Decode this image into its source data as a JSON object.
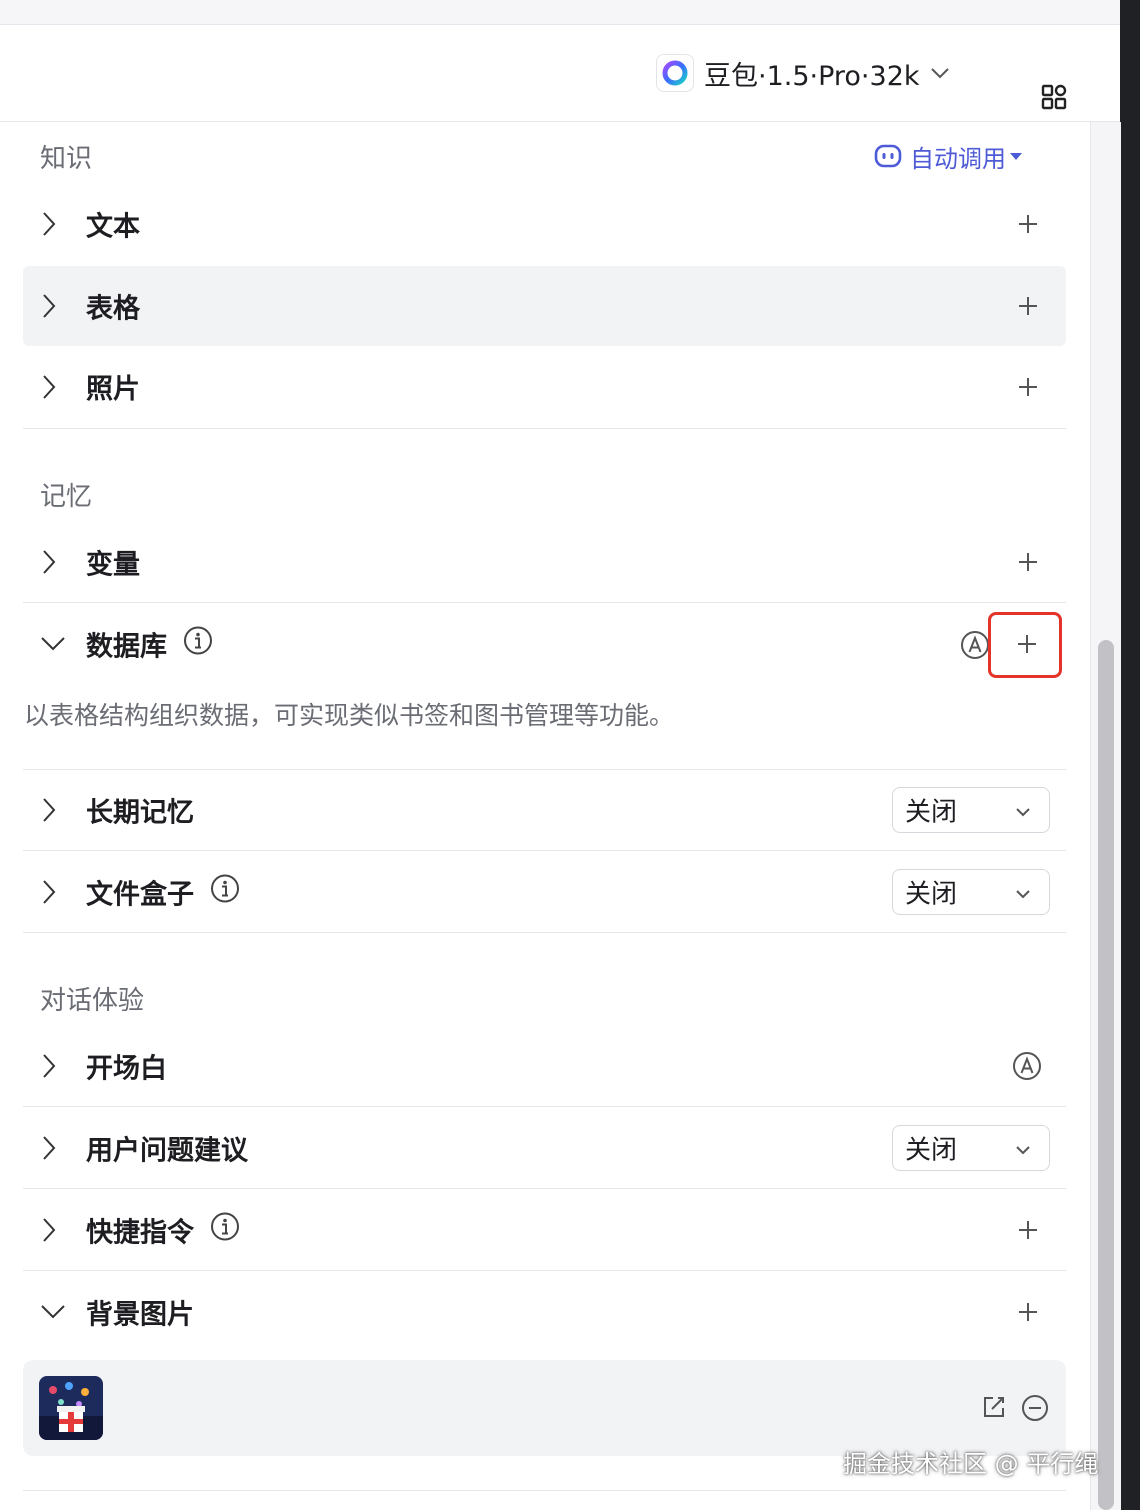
{
  "header": {
    "model_name": "豆包·1.5·Pro·32k"
  },
  "knowledge": {
    "title": "知识",
    "auto_call_label": "自动调用",
    "items": [
      {
        "label": "文本"
      },
      {
        "label": "表格"
      },
      {
        "label": "照片"
      }
    ]
  },
  "memory": {
    "title": "记忆",
    "variables_label": "变量",
    "database_label": "数据库",
    "database_description": "以表格结构组织数据，可实现类似书签和图书管理等功能。",
    "long_term_memory_label": "长期记忆",
    "long_term_memory_value": "关闭",
    "file_box_label": "文件盒子",
    "file_box_value": "关闭"
  },
  "dialog": {
    "title": "对话体验",
    "opening_label": "开场白",
    "suggestions_label": "用户问题建议",
    "suggestions_value": "关闭",
    "shortcuts_label": "快捷指令",
    "background_label": "背景图片"
  },
  "watermark": "掘金技术社区 @ 平行绳",
  "colors": {
    "accent": "#4e5bd6",
    "highlight": "#e4342a",
    "hover_bg": "#f2f3f5"
  }
}
